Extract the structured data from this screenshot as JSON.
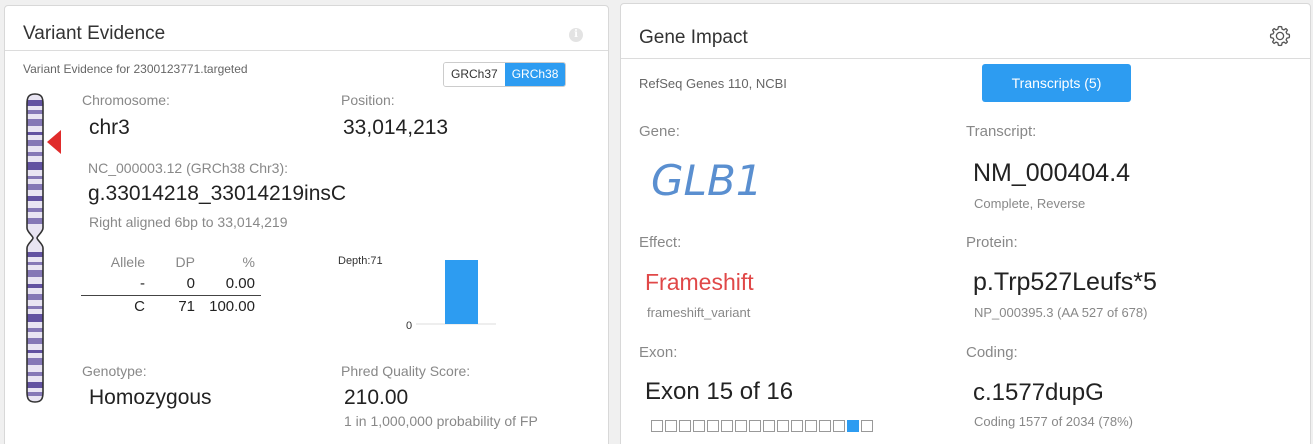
{
  "variant_panel": {
    "title": "Variant Evidence",
    "info_icon": "i",
    "subtitle": "Variant Evidence for 2300123771.targeted",
    "builds": [
      "GRCh37",
      "GRCh38"
    ],
    "active_build": "GRCh38",
    "chromosome_label": "Chromosome:",
    "chromosome": "chr3",
    "position_label": "Position:",
    "position": "33,014,213",
    "ref_label": "NC_000003.12 (GRCh38 Chr3):",
    "hgvs_g": "g.33014218_33014219insC",
    "alignment_note": "Right aligned 6bp to 33,014,219",
    "allele_table": {
      "headers": [
        "Allele",
        "DP",
        "%"
      ],
      "rows": [
        [
          "-",
          "0",
          "0.00"
        ],
        [
          "C",
          "71",
          "100.00"
        ]
      ]
    },
    "depth_label": "Depth:71",
    "depth_zero": "0",
    "depth_value": 71,
    "genotype_label": "Genotype:",
    "genotype": "Homozygous",
    "phred_label": "Phred Quality Score:",
    "phred": "210.00",
    "phred_note": "1 in 1,000,000 probability of FP",
    "colors": {
      "accent": "#2d9cf1",
      "marker": "#e02b2b",
      "ideogram": "#5b4a9c"
    }
  },
  "gene_panel": {
    "title": "Gene Impact",
    "settings_icon": "gear-icon",
    "subtitle": "RefSeq Genes 110, NCBI",
    "transcripts_button": "Transcripts (5)",
    "gene_label": "Gene:",
    "gene": "GLB1",
    "transcript_label": "Transcript:",
    "transcript": "NM_000404.4",
    "transcript_note": "Complete, Reverse",
    "effect_label": "Effect:",
    "effect": "Frameshift",
    "effect_note": "frameshift_variant",
    "protein_label": "Protein:",
    "protein": "p.Trp527Leufs*5",
    "protein_note": "NP_000395.3 (AA 527 of 678)",
    "exon_label": "Exon:",
    "exon": "Exon 15 of 16",
    "exon_total": 16,
    "exon_current": 15,
    "coding_label": "Coding:",
    "coding": "c.1577dupG",
    "coding_note": "Coding 1577 of 2034 (78%)",
    "colors": {
      "gene": "#5a8fd0",
      "effect": "#e04848",
      "button": "#2d9cf1"
    }
  }
}
